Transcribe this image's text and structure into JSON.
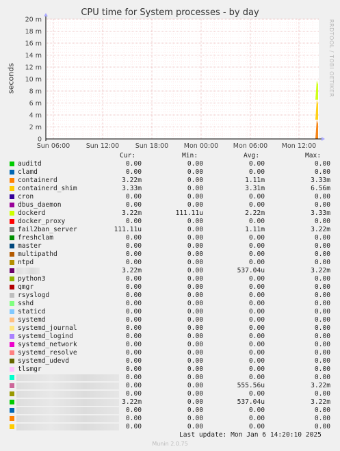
{
  "title": "CPU time for System processes - by day",
  "side_label": "RRDTOOL / TOBI OETIKER",
  "chart_data": {
    "type": "area",
    "title": "CPU time for System processes - by day",
    "ylabel": "seconds",
    "ylim": [
      0,
      20
    ],
    "y_ticks": [
      "0",
      "2 m",
      "4 m",
      "6 m",
      "8 m",
      "10 m",
      "12 m",
      "14 m",
      "16 m",
      "18 m",
      "20 m"
    ],
    "x_ticks": [
      "Sun 06:00",
      "Sun 12:00",
      "Sun 18:00",
      "Mon 00:00",
      "Mon 06:00",
      "Mon 12:00"
    ],
    "grid": true,
    "series": [
      {
        "name": "containerd",
        "color": "#F57900",
        "values": [
          3.22
        ]
      },
      {
        "name": "containerd_shim",
        "color": "#FFCC00",
        "values": [
          3.33
        ]
      },
      {
        "name": "dockerd",
        "color": "#CCFF00",
        "values": [
          3.22
        ]
      }
    ]
  },
  "legend": {
    "headers": {
      "cur": "Cur:",
      "min": "Min:",
      "avg": "Avg:",
      "max": "Max:"
    },
    "rows": [
      {
        "name": "auditd",
        "color": "#00CC00",
        "cur": "0.00",
        "min": "0.00",
        "avg": "0.00",
        "max": "0.00"
      },
      {
        "name": "clamd",
        "color": "#0066B3",
        "cur": "0.00",
        "min": "0.00",
        "avg": "0.00",
        "max": "0.00"
      },
      {
        "name": "containerd",
        "color": "#FF8000",
        "cur": "3.22m",
        "min": "0.00",
        "avg": "1.11m",
        "max": "3.33m"
      },
      {
        "name": "containerd_shim",
        "color": "#FFCC00",
        "cur": "3.33m",
        "min": "0.00",
        "avg": "3.31m",
        "max": "6.56m"
      },
      {
        "name": "cron",
        "color": "#330099",
        "cur": "0.00",
        "min": "0.00",
        "avg": "0.00",
        "max": "0.00"
      },
      {
        "name": "dbus_daemon",
        "color": "#990099",
        "cur": "0.00",
        "min": "0.00",
        "avg": "0.00",
        "max": "0.00"
      },
      {
        "name": "dockerd",
        "color": "#CCFF00",
        "cur": "3.22m",
        "min": "111.11u",
        "avg": "2.22m",
        "max": "3.33m"
      },
      {
        "name": "docker_proxy",
        "color": "#FF0000",
        "cur": "0.00",
        "min": "0.00",
        "avg": "0.00",
        "max": "0.00"
      },
      {
        "name": "fail2ban_server",
        "color": "#808080",
        "cur": "111.11u",
        "min": "0.00",
        "avg": "1.11m",
        "max": "3.22m"
      },
      {
        "name": "freshclam",
        "color": "#008F00",
        "cur": "0.00",
        "min": "0.00",
        "avg": "0.00",
        "max": "0.00"
      },
      {
        "name": "master",
        "color": "#00487D",
        "cur": "0.00",
        "min": "0.00",
        "avg": "0.00",
        "max": "0.00"
      },
      {
        "name": "multipathd",
        "color": "#B35A00",
        "cur": "0.00",
        "min": "0.00",
        "avg": "0.00",
        "max": "0.00"
      },
      {
        "name": "ntpd",
        "color": "#B38F00",
        "cur": "0.00",
        "min": "0.00",
        "avg": "0.00",
        "max": "0.00"
      },
      {
        "name": "",
        "color": "#6B006B",
        "cur": "3.22m",
        "min": "0.00",
        "avg": "537.04u",
        "max": "3.22m",
        "redacted": true
      },
      {
        "name": "python3",
        "color": "#8FB300",
        "cur": "0.00",
        "min": "0.00",
        "avg": "0.00",
        "max": "0.00"
      },
      {
        "name": "qmgr",
        "color": "#B30000",
        "cur": "0.00",
        "min": "0.00",
        "avg": "0.00",
        "max": "0.00"
      },
      {
        "name": "rsyslogd",
        "color": "#BEBEBE",
        "cur": "0.00",
        "min": "0.00",
        "avg": "0.00",
        "max": "0.00"
      },
      {
        "name": "sshd",
        "color": "#80FF80",
        "cur": "0.00",
        "min": "0.00",
        "avg": "0.00",
        "max": "0.00"
      },
      {
        "name": "staticd",
        "color": "#80C9FF",
        "cur": "0.00",
        "min": "0.00",
        "avg": "0.00",
        "max": "0.00"
      },
      {
        "name": "systemd",
        "color": "#FFC080",
        "cur": "0.00",
        "min": "0.00",
        "avg": "0.00",
        "max": "0.00"
      },
      {
        "name": "systemd_journal",
        "color": "#FFE680",
        "cur": "0.00",
        "min": "0.00",
        "avg": "0.00",
        "max": "0.00"
      },
      {
        "name": "systemd_logind",
        "color": "#AA80FF",
        "cur": "0.00",
        "min": "0.00",
        "avg": "0.00",
        "max": "0.00"
      },
      {
        "name": "systemd_network",
        "color": "#EE00CC",
        "cur": "0.00",
        "min": "0.00",
        "avg": "0.00",
        "max": "0.00"
      },
      {
        "name": "systemd_resolve",
        "color": "#FF8080",
        "cur": "0.00",
        "min": "0.00",
        "avg": "0.00",
        "max": "0.00"
      },
      {
        "name": "systemd_udevd",
        "color": "#666600",
        "cur": "0.00",
        "min": "0.00",
        "avg": "0.00",
        "max": "0.00"
      },
      {
        "name": "tlsmgr",
        "color": "#FFBFFF",
        "cur": "0.00",
        "min": "0.00",
        "avg": "0.00",
        "max": "0.00"
      },
      {
        "name": "",
        "color": "#00FFCC",
        "cur": "0.00",
        "min": "0.00",
        "avg": "0.00",
        "max": "0.00",
        "redacted": true
      },
      {
        "name": "",
        "color": "#CC6699",
        "cur": "0.00",
        "min": "0.00",
        "avg": "555.56u",
        "max": "3.22m",
        "redacted": true
      },
      {
        "name": "",
        "color": "#999900",
        "cur": "0.00",
        "min": "0.00",
        "avg": "0.00",
        "max": "0.00",
        "redacted": true
      },
      {
        "name": "",
        "color": "#00CC00",
        "cur": "3.22m",
        "min": "0.00",
        "avg": "537.04u",
        "max": "3.22m",
        "redacted": true
      },
      {
        "name": "",
        "color": "#0066B3",
        "cur": "0.00",
        "min": "0.00",
        "avg": "0.00",
        "max": "0.00",
        "redacted": true
      },
      {
        "name": "",
        "color": "#FF8000",
        "cur": "0.00",
        "min": "0.00",
        "avg": "0.00",
        "max": "0.00",
        "redacted": true
      },
      {
        "name": "",
        "color": "#FFCC00",
        "cur": "0.00",
        "min": "0.00",
        "avg": "0.00",
        "max": "0.00",
        "redacted": true
      }
    ]
  },
  "footer": "Last update: Mon Jan  6 14:20:10 2025",
  "version": "Munin 2.0.75"
}
